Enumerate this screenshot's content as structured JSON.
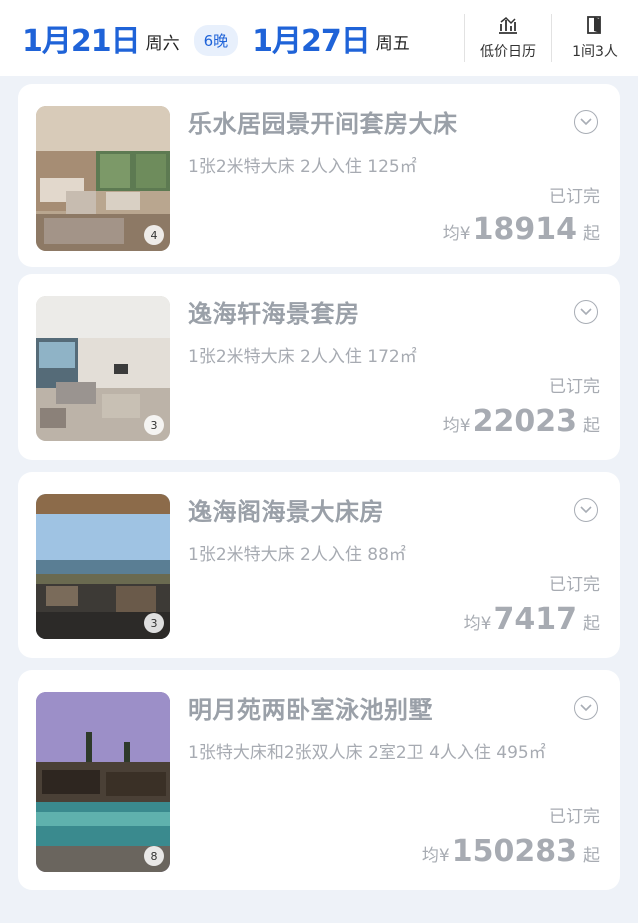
{
  "header": {
    "checkin_date": "1月21日",
    "checkin_weekday": "周六",
    "nights": "6晚",
    "checkout_date": "1月27日",
    "checkout_weekday": "周五",
    "calendar_label": "低价日历",
    "guests_label": "1间3人"
  },
  "colors": {
    "accent": "#1f63d8",
    "muted": "#a7abb2",
    "background": "#eef2f8"
  },
  "rooms": [
    {
      "name": "乐水居园景开间套房大床",
      "info": "1张2米特大床  2人入住  125㎡",
      "photo_count": "4",
      "status": "已订完",
      "price_prefix": "均¥",
      "price": "18914",
      "price_suffix": "起"
    },
    {
      "name": "逸海轩海景套房",
      "info": "1张2米特大床  2人入住  172㎡",
      "photo_count": "3",
      "status": "已订完",
      "price_prefix": "均¥",
      "price": "22023",
      "price_suffix": "起"
    },
    {
      "name": "逸海阁海景大床房",
      "info": "1张2米特大床  2人入住  88㎡",
      "photo_count": "3",
      "status": "已订完",
      "price_prefix": "均¥",
      "price": "7417",
      "price_suffix": "起"
    },
    {
      "name": "明月苑两卧室泳池别墅",
      "info": "1张特大床和2张双人床  2室2卫  4人入住  495㎡",
      "photo_count": "8",
      "status": "已订完",
      "price_prefix": "均¥",
      "price": "150283",
      "price_suffix": "起"
    }
  ]
}
